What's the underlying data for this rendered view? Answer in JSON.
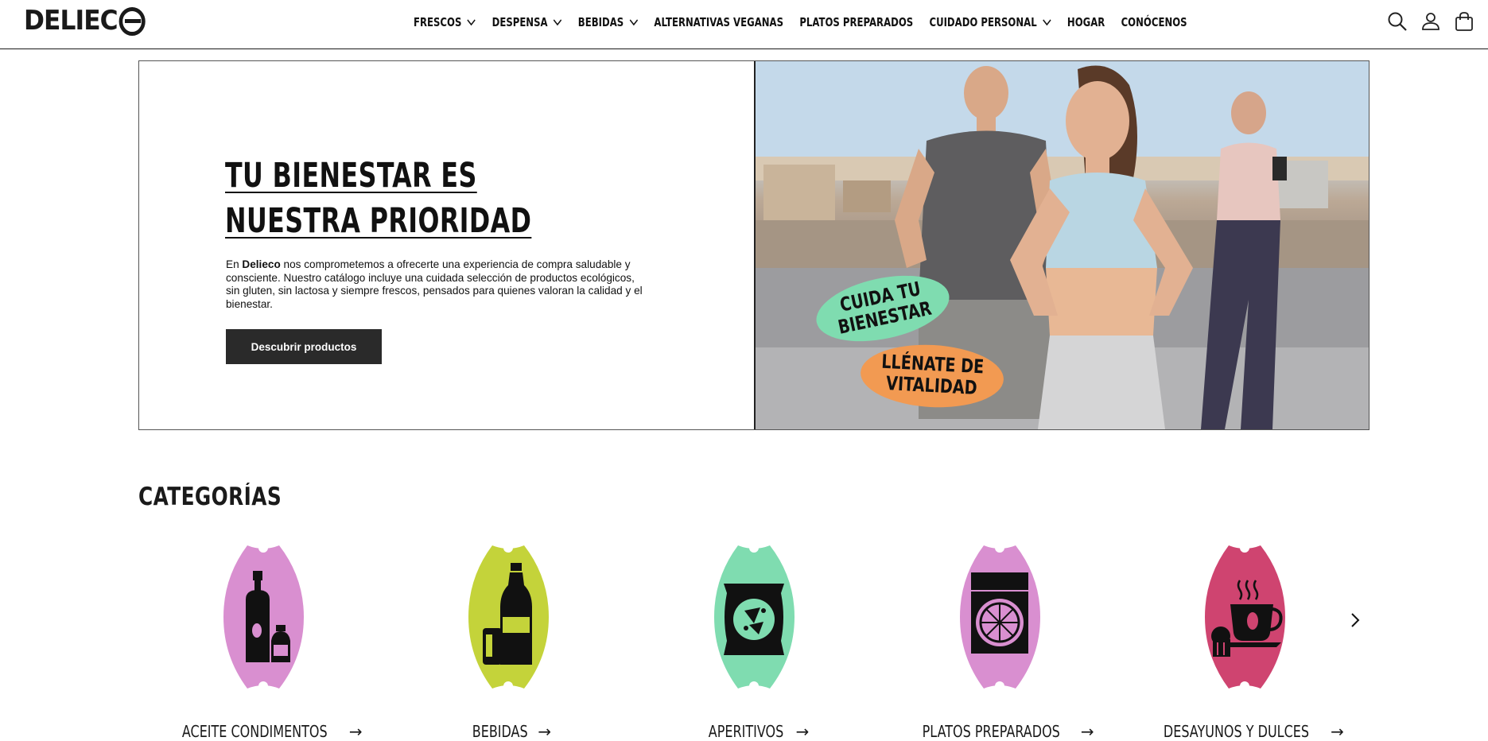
{
  "brand": {
    "logo_text": "DELIEC"
  },
  "nav": {
    "items": [
      {
        "label": "FRESCOS",
        "has_dropdown": true
      },
      {
        "label": "DESPENSA",
        "has_dropdown": true
      },
      {
        "label": "BEBIDAS",
        "has_dropdown": true
      },
      {
        "label": "ALTERNATIVAS VEGANAS",
        "has_dropdown": false
      },
      {
        "label": "PLATOS PREPARADOS",
        "has_dropdown": false
      },
      {
        "label": "CUIDADO PERSONAL",
        "has_dropdown": true
      },
      {
        "label": "HOGAR",
        "has_dropdown": false
      },
      {
        "label": "CONÓCENOS",
        "has_dropdown": false
      }
    ],
    "icons": [
      "search-icon",
      "account-icon",
      "cart-icon"
    ]
  },
  "hero": {
    "title": "TU BIENESTAR ES NUESTRA PRIORIDAD",
    "body_prefix": "En ",
    "body_brand": "Delieco",
    "body_rest": " nos comprometemos a ofrecerte una experiencia de compra saludable y consciente. Nuestro catálogo incluye una cuidada selección de productos ecológicos, sin gluten, sin lactosa y siempre frescos, pensados para quienes valoran la calidad y el bienestar.",
    "cta_label": "Descubrir productos",
    "sticker_1_line_1": "CUIDA TU",
    "sticker_1_line_2": "BIENESTAR",
    "sticker_2_line_1": "LLÉNATE DE",
    "sticker_2_line_2": "VITALIDAD"
  },
  "categories": {
    "heading": "CATEGORÍAS",
    "items": [
      {
        "label": "ACEITE CONDIMENTOS",
        "color": "#d98fd0",
        "icon": "oil-bottle-icon"
      },
      {
        "label": "BEBIDAS",
        "color": "#c4d33a",
        "icon": "soda-bottle-icon"
      },
      {
        "label": "APERITIVOS",
        "color": "#7fdcb0",
        "icon": "chips-bag-icon"
      },
      {
        "label": "PLATOS PREPARADOS",
        "color": "#d98fd0",
        "icon": "pizza-box-icon"
      },
      {
        "label": "DESAYUNOS Y DULCES",
        "color": "#cf4470",
        "icon": "coffee-cup-icon"
      }
    ],
    "next_icon": "chevron-right-icon"
  }
}
